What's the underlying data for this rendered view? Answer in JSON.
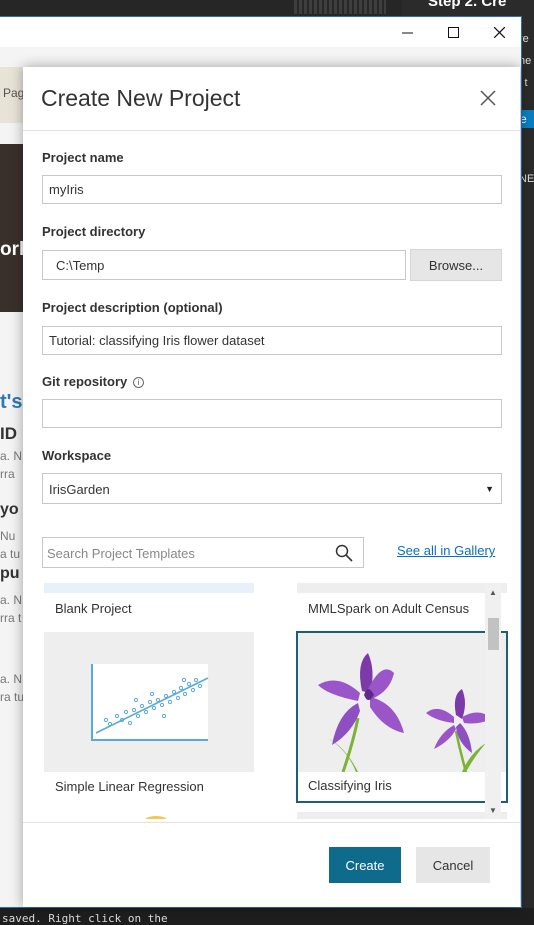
{
  "background": {
    "right_title": "Step 2. Cre",
    "right_link": "e",
    "right_texts": [
      "re",
      "ne",
      "l t",
      "NE"
    ],
    "left_tab": "Pag",
    "left_hero": "ork",
    "left_texts": [
      "t's",
      "ID",
      "a. N",
      "rra",
      "yo",
      "Nu",
      "a tu",
      "pu",
      "a. N",
      "rra t",
      "a. N",
      "ra tu"
    ],
    "bottom_code": "saved. Right click on the"
  },
  "window": {
    "minimize_glyph": "—",
    "maximize_glyph": "☐",
    "close_glyph": "✕"
  },
  "dialog": {
    "title": "Create New Project",
    "project_name": {
      "label": "Project name",
      "value": "myIris"
    },
    "project_directory": {
      "label": "Project directory",
      "value": "C:\\Temp",
      "browse_label": "Browse..."
    },
    "project_description": {
      "label": "Project description (optional)",
      "value": "Tutorial: classifying Iris flower dataset"
    },
    "git_repository": {
      "label": "Git repository",
      "info_glyph": "i",
      "value": ""
    },
    "workspace": {
      "label": "Workspace",
      "selected": "IrisGarden",
      "arrow": "▼"
    },
    "search": {
      "placeholder": "Search Project Templates"
    },
    "gallery_link": "See all in Gallery",
    "templates": [
      {
        "name": "Blank Project",
        "selected": false
      },
      {
        "name": "MMLSpark on Adult Census",
        "selected": false
      },
      {
        "name": "Simple Linear Regression",
        "selected": false
      },
      {
        "name": "Classifying Iris",
        "selected": true
      }
    ],
    "scroll_up": "▲",
    "scroll_down": "▼",
    "create_label": "Create",
    "cancel_label": "Cancel",
    "colors": {
      "accent": "#0f6b8c",
      "link": "#0a6fc2",
      "iris": "#8e4fc2",
      "selection_border": "#1a5e78"
    }
  }
}
